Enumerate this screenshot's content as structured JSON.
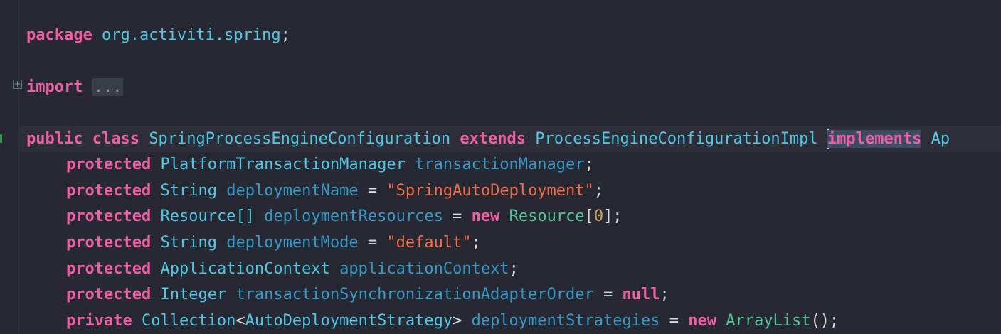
{
  "code": {
    "package_line": {
      "kw": "package",
      "name": "org.activiti.spring",
      "semicolon": ";"
    },
    "import_line": {
      "kw": "import",
      "folded": "..."
    },
    "class_line": {
      "kw_public": "public",
      "kw_class": "class",
      "class_name": "SpringProcessEngineConfiguration",
      "kw_extends": "extends",
      "super_name": "ProcessEngineConfigurationImpl",
      "kw_implements": "implements",
      "iface_partial": "Ap"
    },
    "fields": [
      {
        "modifier": "protected",
        "type": "PlatformTransactionManager",
        "name": "transactionManager",
        "suffix": ";"
      },
      {
        "modifier": "protected",
        "type": "String",
        "name": "deploymentName",
        "eq": " = ",
        "value": "\"SpringAutoDeployment\"",
        "suffix": ";"
      },
      {
        "modifier": "protected",
        "type": "Resource[]",
        "name": "deploymentResources",
        "eq": " = ",
        "new": "new",
        "ctor": "Resource",
        "open": "[",
        "num": "0",
        "close": "];"
      },
      {
        "modifier": "protected",
        "type": "String",
        "name": "deploymentMode",
        "eq": " = ",
        "value": "\"default\"",
        "suffix": ";"
      },
      {
        "modifier": "protected",
        "type": "ApplicationContext",
        "name": "applicationContext",
        "suffix": ";"
      },
      {
        "modifier": "protected",
        "type": "Integer",
        "name": "transactionSynchronizationAdapterOrder",
        "eq": " = ",
        "null": "null",
        "suffix": ";"
      },
      {
        "modifier": "private",
        "type": "Collection",
        "lt": "<",
        "generic": "AutoDeploymentStrategy",
        "gt": ">",
        "name": "deploymentStrategies",
        "eq": " = ",
        "new": "new",
        "ctor": "ArrayList",
        "close": "();"
      }
    ]
  },
  "colors": {
    "background": "#262932",
    "keyword": "#f05fa5",
    "type": "#52c6e4",
    "field": "#3a98c7",
    "string": "#f46c4c",
    "number": "#c7a65b",
    "constructor": "#56c39b"
  },
  "icons": [
    "fold-expand-icon",
    "run-gutter-marker"
  ]
}
